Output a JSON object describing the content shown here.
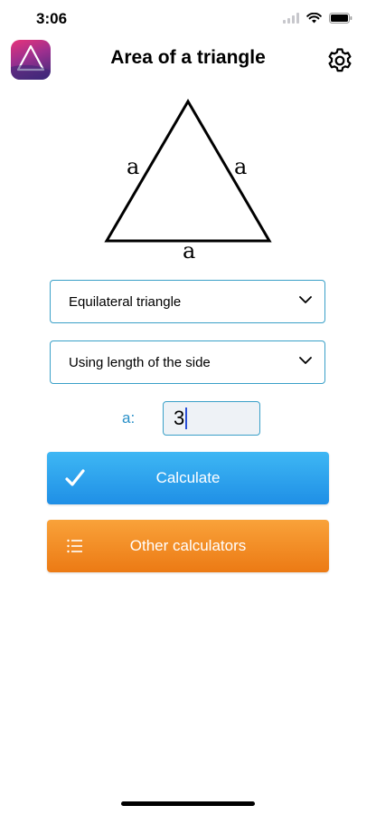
{
  "status_bar": {
    "time": "3:06"
  },
  "header": {
    "title": "Area of a triangle"
  },
  "diagram": {
    "labels": {
      "left": "a",
      "right": "a",
      "bottom": "a"
    }
  },
  "selects": {
    "triangle_type": "Equilateral triangle",
    "method": "Using length of the side"
  },
  "field": {
    "label": "a:",
    "value": "3"
  },
  "buttons": {
    "calculate": "Calculate",
    "other": "Other calculators"
  },
  "icons": {
    "settings": "gear-icon",
    "app": "triangle-app-icon",
    "calculate": "checkmark-icon",
    "other": "list-icon",
    "dropdown": "chevron-down-icon"
  },
  "colors": {
    "accent": "#3aa0c8",
    "calculate": "#2aa3ee",
    "other": "#f2891f"
  }
}
